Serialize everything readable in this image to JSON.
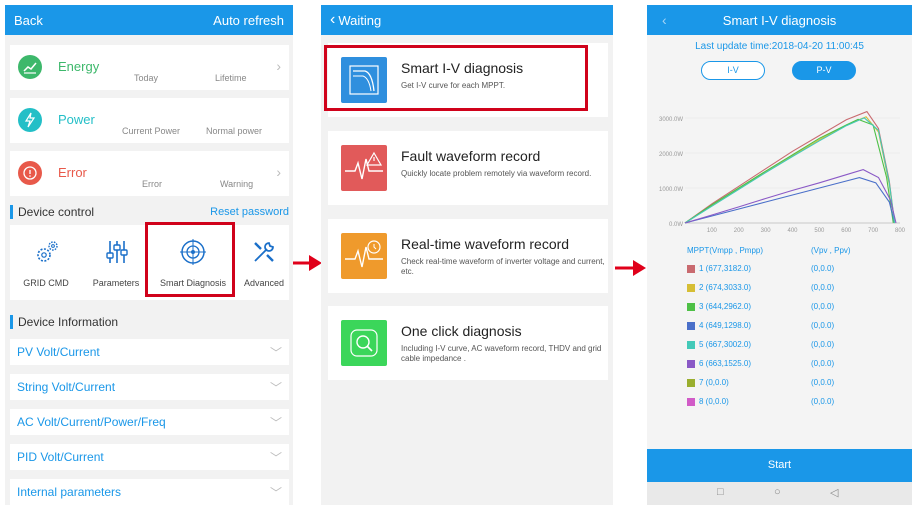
{
  "screen1": {
    "header": {
      "back": "Back",
      "auto_refresh": "Auto refresh"
    },
    "cards": [
      {
        "title": "Energy",
        "sub1": "Today",
        "sub2": "Lifetime",
        "icon": "chart-icon",
        "color": "#3db86b"
      },
      {
        "title": "Power",
        "sub1": "Current Power",
        "sub2": "Normal power",
        "icon": "bolt-icon",
        "color": "#23bfc7"
      },
      {
        "title": "Error",
        "sub1": "Error",
        "sub2": "Warning",
        "icon": "alert-icon",
        "color": "#e8594a"
      }
    ],
    "device_control": {
      "title": "Device control",
      "reset": "Reset password"
    },
    "dc_items": [
      "GRID CMD",
      "Parameters",
      "Smart Diagnosis",
      "Advanced"
    ],
    "device_info_title": "Device Information",
    "info_rows": [
      "PV Volt/Current",
      "String Volt/Current",
      "AC Volt/Current/Power/Freq",
      "PID Volt/Current",
      "Internal parameters"
    ]
  },
  "screen2": {
    "header": {
      "title": "Waiting"
    },
    "items": [
      {
        "title": "Smart I-V diagnosis",
        "desc": "Get I-V curve for each MPPT.",
        "color": "#2f8fde",
        "icon": "iv-curve-icon"
      },
      {
        "title": "Fault waveform record",
        "desc": "Quickly locate problem remotely via waveform record.",
        "color": "#e15a5a",
        "icon": "fault-wave-icon"
      },
      {
        "title": "Real-time waveform record",
        "desc": "Check real-time waveform of inverter voltage and current, etc.",
        "color": "#ef9a2c",
        "icon": "realtime-wave-icon"
      },
      {
        "title": "One click diagnosis",
        "desc": "Including I-V curve, AC waveform record, THDV and grid cable impedance .",
        "color": "#3bd65a",
        "icon": "magnify-icon"
      }
    ]
  },
  "screen3": {
    "header": {
      "title": "Smart I-V diagnosis"
    },
    "last_update": "Last update time:2018-04-20 11:00:45",
    "tabs": [
      "I-V",
      "P-V"
    ],
    "active_tab": "P-V",
    "legend_headers": [
      "MPPT(Vmpp , Pmpp)",
      "(Vpv , Ppv)"
    ],
    "legend": [
      {
        "id": "1",
        "mpp": "(677,3182.0)",
        "pv": "(0,0.0)",
        "color": "#c96a6f"
      },
      {
        "id": "2",
        "mpp": "(674,3033.0)",
        "pv": "(0,0.0)",
        "color": "#d6be35"
      },
      {
        "id": "3",
        "mpp": "(644,2962.0)",
        "pv": "(0,0.0)",
        "color": "#4ec046"
      },
      {
        "id": "4",
        "mpp": "(649,1298.0)",
        "pv": "(0,0.0)",
        "color": "#4a6fc9"
      },
      {
        "id": "5",
        "mpp": "(667,3002.0)",
        "pv": "(0,0.0)",
        "color": "#43c9b8"
      },
      {
        "id": "6",
        "mpp": "(663,1525.0)",
        "pv": "(0,0.0)",
        "color": "#8a59c6"
      },
      {
        "id": "7",
        "mpp": "(0,0.0)",
        "pv": "(0,0.0)",
        "color": "#9aae2e"
      },
      {
        "id": "8",
        "mpp": "(0,0.0)",
        "pv": "(0,0.0)",
        "color": "#d15bc7"
      }
    ],
    "start": "Start",
    "nav": [
      "□",
      "○",
      "◁"
    ]
  },
  "chart_data": {
    "type": "line",
    "xlabel": "",
    "ylabel": "",
    "xlim": [
      0,
      800
    ],
    "ylim": [
      0,
      3200
    ],
    "x_ticks": [
      "100",
      "200",
      "300",
      "400",
      "500",
      "600",
      "700",
      "800"
    ],
    "y_ticks": [
      "0.0W",
      "1000.0W",
      "2000.0W",
      "3000.0W"
    ],
    "series": [
      {
        "name": "1",
        "color": "#c96a6f",
        "points": [
          [
            0,
            0
          ],
          [
            100,
            550
          ],
          [
            200,
            1050
          ],
          [
            300,
            1550
          ],
          [
            400,
            2050
          ],
          [
            500,
            2500
          ],
          [
            600,
            2950
          ],
          [
            677,
            3182
          ],
          [
            720,
            2700
          ],
          [
            760,
            1200
          ],
          [
            780,
            0
          ]
        ]
      },
      {
        "name": "2",
        "color": "#d6be35",
        "points": [
          [
            0,
            0
          ],
          [
            100,
            500
          ],
          [
            200,
            980
          ],
          [
            300,
            1450
          ],
          [
            400,
            1920
          ],
          [
            500,
            2380
          ],
          [
            600,
            2800
          ],
          [
            674,
            3033
          ],
          [
            720,
            2600
          ],
          [
            760,
            1100
          ],
          [
            780,
            0
          ]
        ]
      },
      {
        "name": "3",
        "color": "#4ec046",
        "points": [
          [
            0,
            0
          ],
          [
            100,
            520
          ],
          [
            200,
            1000
          ],
          [
            300,
            1480
          ],
          [
            400,
            1950
          ],
          [
            500,
            2420
          ],
          [
            600,
            2800
          ],
          [
            644,
            2962
          ],
          [
            700,
            2800
          ],
          [
            750,
            1300
          ],
          [
            775,
            0
          ]
        ]
      },
      {
        "name": "4",
        "color": "#4a6fc9",
        "points": [
          [
            0,
            0
          ],
          [
            100,
            200
          ],
          [
            200,
            400
          ],
          [
            300,
            600
          ],
          [
            400,
            800
          ],
          [
            500,
            1000
          ],
          [
            600,
            1200
          ],
          [
            649,
            1298
          ],
          [
            710,
            1150
          ],
          [
            760,
            600
          ],
          [
            780,
            0
          ]
        ]
      },
      {
        "name": "5",
        "color": "#43c9b8",
        "points": [
          [
            0,
            0
          ],
          [
            100,
            480
          ],
          [
            200,
            960
          ],
          [
            300,
            1440
          ],
          [
            400,
            1900
          ],
          [
            500,
            2350
          ],
          [
            600,
            2780
          ],
          [
            667,
            3002
          ],
          [
            720,
            2650
          ],
          [
            760,
            1150
          ],
          [
            780,
            0
          ]
        ]
      },
      {
        "name": "6",
        "color": "#8a59c6",
        "points": [
          [
            0,
            0
          ],
          [
            100,
            230
          ],
          [
            200,
            460
          ],
          [
            300,
            700
          ],
          [
            400,
            930
          ],
          [
            500,
            1150
          ],
          [
            600,
            1380
          ],
          [
            663,
            1525
          ],
          [
            720,
            1300
          ],
          [
            765,
            650
          ],
          [
            785,
            0
          ]
        ]
      }
    ]
  }
}
